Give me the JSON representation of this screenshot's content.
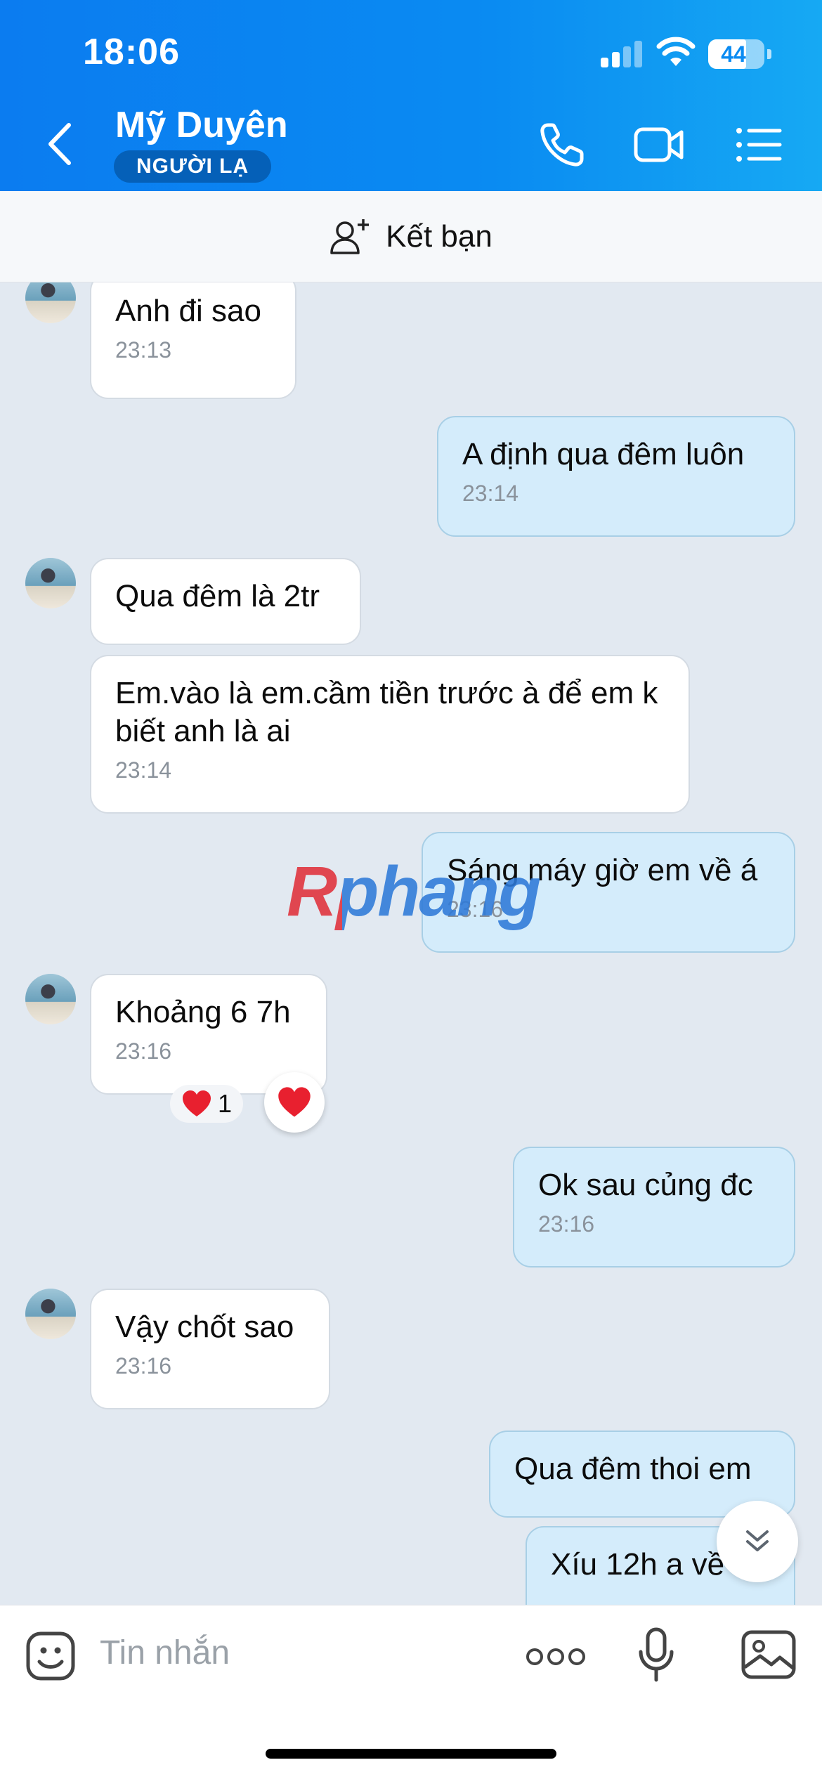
{
  "status_bar": {
    "time": "18:06",
    "battery": "44"
  },
  "header": {
    "contact_name": "Mỹ Duyên",
    "badge": "NGƯỜI LẠ"
  },
  "friend_bar": {
    "label": "Kết bạn"
  },
  "messages": [
    {
      "dir": "in",
      "text": "Anh đi sao",
      "time": "23:13"
    },
    {
      "dir": "out",
      "text": "A định qua đêm luôn",
      "time": "23:14"
    },
    {
      "dir": "in",
      "text": "Qua đêm là 2tr"
    },
    {
      "dir": "in",
      "text": "Em.vào là em.cầm tiền trước à để em k biết anh là ai",
      "time": "23:14"
    },
    {
      "dir": "out",
      "text": "Sáng máy giờ em về á",
      "time": "23:16"
    },
    {
      "dir": "in",
      "text": "Khoảng 6 7h",
      "time": "23:16",
      "reaction_count": "1"
    },
    {
      "dir": "out",
      "text": "Ok sau củng đc",
      "time": "23:16"
    },
    {
      "dir": "in",
      "text": "Vậy chốt sao",
      "time": "23:16"
    },
    {
      "dir": "out",
      "text": "Qua đêm thoi em"
    },
    {
      "dir": "out",
      "text": "Xíu 12h a về rồ"
    }
  ],
  "watermark": "Rphang",
  "composer": {
    "placeholder": "Tin nhắn"
  },
  "icons": {
    "back": "chevron-left-icon",
    "call": "phone-icon",
    "video": "video-camera-icon",
    "menu": "list-menu-icon",
    "add_friend": "add-person-icon",
    "sticker": "sticker-face-icon",
    "more": "more-dots-icon",
    "mic": "microphone-icon",
    "image": "image-icon",
    "scroll": "double-chevron-down-icon",
    "reaction": "heart-icon"
  },
  "colors": {
    "header_start": "#0b7cf0",
    "header_end": "#16a9f3",
    "badge": "#0560b8",
    "outgoing_bubble": "#d4ecfb",
    "incoming_bubble": "#ffffff",
    "heart": "#e8202f"
  }
}
